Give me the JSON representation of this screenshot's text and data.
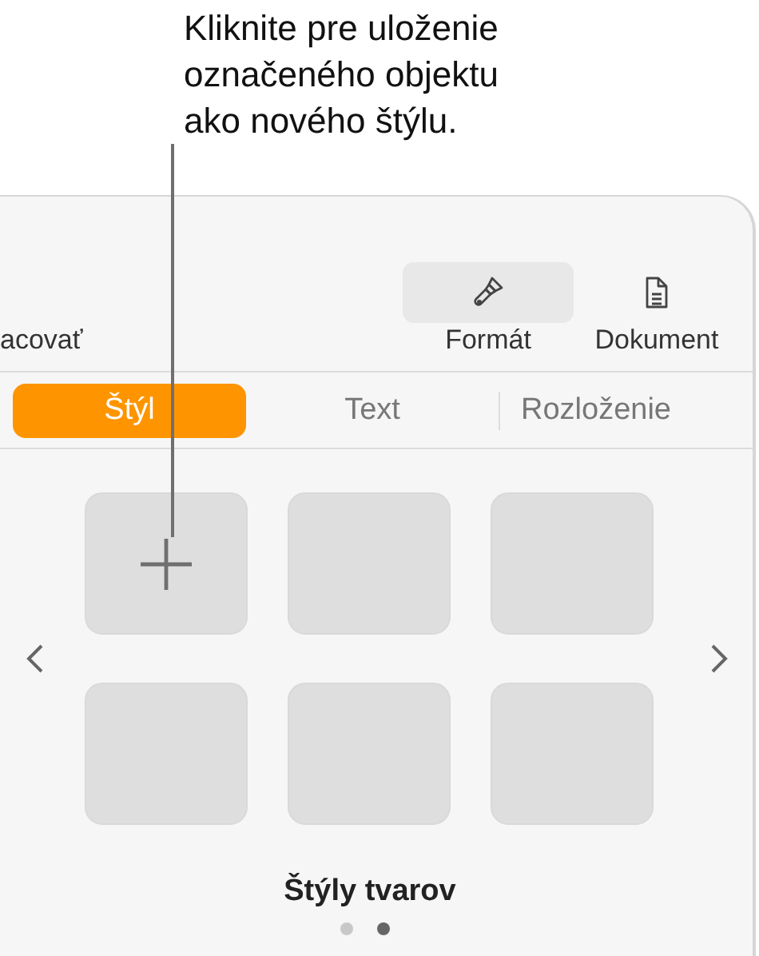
{
  "callout": {
    "text": "Kliknite pre uloženie označeného objektu ako nového štýlu."
  },
  "toolbar": {
    "items": [
      {
        "kind": "text",
        "label": "acovať",
        "selected": false
      },
      {
        "kind": "format",
        "label": "Formát",
        "selected": true
      },
      {
        "kind": "document",
        "label": "Dokument",
        "selected": false
      }
    ]
  },
  "tabs": [
    {
      "label": "Štýl",
      "selected": true
    },
    {
      "label": "Text",
      "selected": false
    },
    {
      "label": "Rozloženie",
      "selected": false
    }
  ],
  "styles": {
    "tiles": [
      {
        "kind": "add"
      },
      {
        "kind": "empty"
      },
      {
        "kind": "empty"
      },
      {
        "kind": "empty"
      },
      {
        "kind": "empty"
      },
      {
        "kind": "empty"
      }
    ],
    "title": "Štýly tvarov",
    "pages": [
      {
        "selected": false
      },
      {
        "selected": true
      }
    ]
  }
}
